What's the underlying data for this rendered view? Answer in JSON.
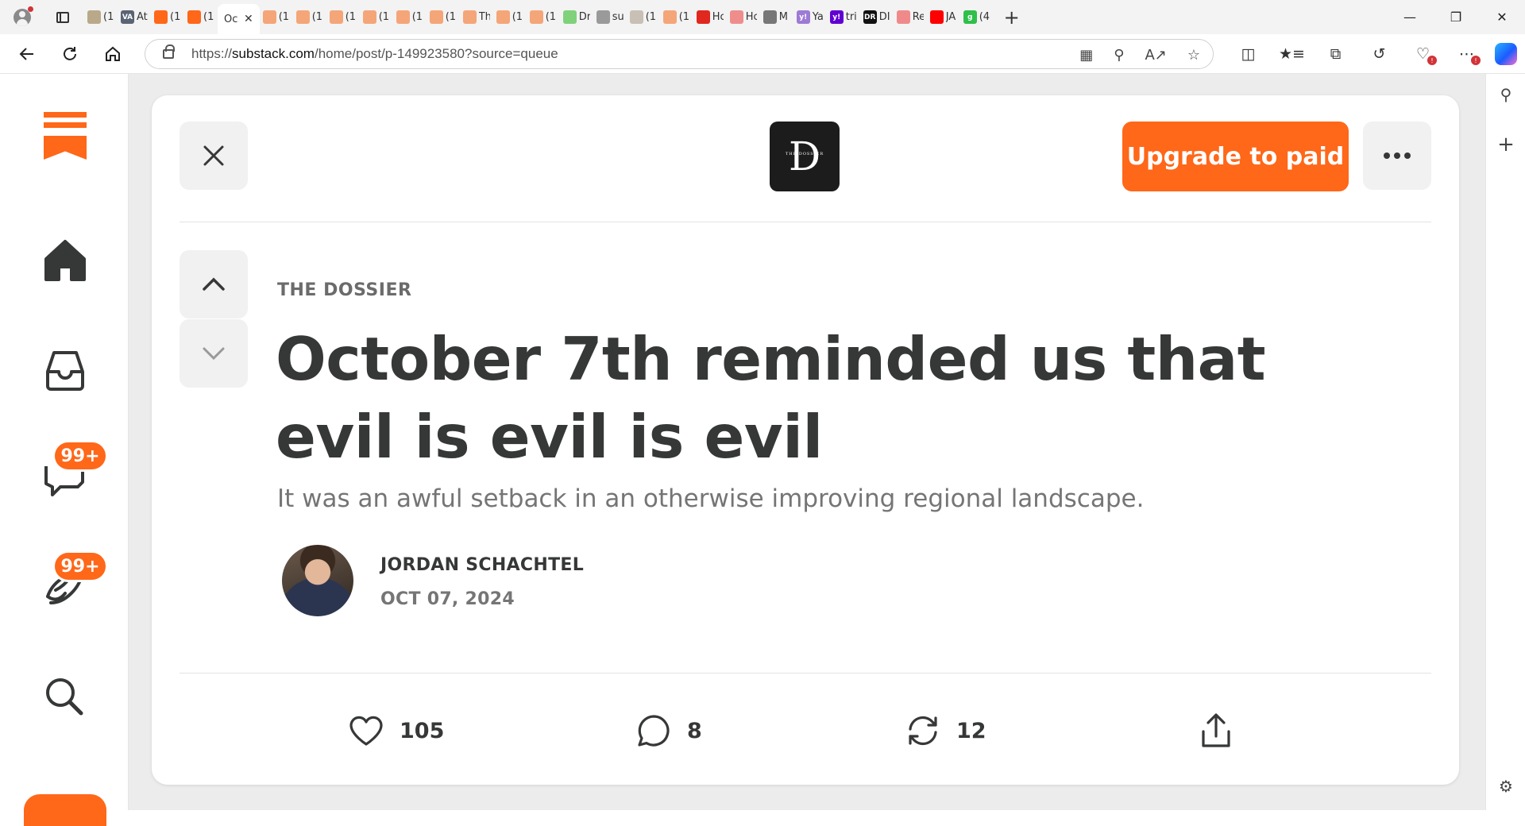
{
  "browser": {
    "active_tab_title": "Oc",
    "tabs": [
      {
        "title": "(1(",
        "icon": "image-thumb-icon",
        "color": "#b9a98a"
      },
      {
        "title": "At",
        "icon": "va-icon",
        "color": "#5a6473",
        "glyph": "VA"
      },
      {
        "title": "(1(",
        "icon": "substack-icon",
        "color": "#ff6719"
      },
      {
        "title": "(1(",
        "icon": "substack-icon",
        "color": "#ff6719"
      },
      {
        "title": "(1(",
        "icon": "substack-icon",
        "color": "#f4a679"
      },
      {
        "title": "(1(",
        "icon": "substack-icon",
        "color": "#f4a679"
      },
      {
        "title": "(1(",
        "icon": "substack-icon",
        "color": "#f4a679"
      },
      {
        "title": "(1(",
        "icon": "substack-icon",
        "color": "#f4a679"
      },
      {
        "title": "(1(",
        "icon": "substack-icon",
        "color": "#f4a679"
      },
      {
        "title": "(1(",
        "icon": "substack-icon",
        "color": "#f4a679"
      },
      {
        "title": "Th",
        "icon": "substack-icon",
        "color": "#f4a679"
      },
      {
        "title": "(1(",
        "icon": "substack-icon",
        "color": "#f4a679"
      },
      {
        "title": "(1(",
        "icon": "substack-icon",
        "color": "#f4a679"
      },
      {
        "title": "Dr",
        "icon": "play-icon",
        "color": "#7fd27a"
      },
      {
        "title": "su",
        "icon": "doc-search-icon",
        "color": "#9a9a9a"
      },
      {
        "title": "(1(",
        "icon": "image-thumb-icon",
        "color": "#c8c0b5"
      },
      {
        "title": "(1(",
        "icon": "substack-icon",
        "color": "#f4a679"
      },
      {
        "title": "Hc",
        "icon": "podcast-icon",
        "color": "#e0281e"
      },
      {
        "title": "Hc",
        "icon": "podcast-icon",
        "color": "#ef8d8d"
      },
      {
        "title": "M",
        "icon": "search-icon",
        "color": "#777777"
      },
      {
        "title": "Ya",
        "icon": "yahoo-icon",
        "color": "#9d7ad6",
        "glyph": "y!"
      },
      {
        "title": "tri",
        "icon": "yahoo-icon",
        "color": "#6001d2",
        "glyph": "y!"
      },
      {
        "title": "DI",
        "icon": "dr-icon",
        "color": "#111111",
        "glyph": "DR"
      },
      {
        "title": "Re",
        "icon": "youtube-icon",
        "color": "#f08a8a"
      },
      {
        "title": "JA",
        "icon": "youtube-icon",
        "color": "#ff0000"
      },
      {
        "title": "(4",
        "icon": "g-icon",
        "color": "#2fbf4a",
        "glyph": "g"
      }
    ],
    "url_prefix": "https://",
    "url_host": "substack.com",
    "url_path": "/home/post/p-149923580?source=queue"
  },
  "substack": {
    "brand_color": "#ff6719",
    "nav_badges": {
      "chat": "99+",
      "activity": "99+"
    },
    "publication_logo_letter": "D",
    "publication_logo_caption": "THE DOSSIER",
    "upgrade_label": "Upgrade to paid",
    "publication_name": "THE DOSSIER",
    "title": "October 7th reminded us that evil is evil is evil",
    "subtitle": "It was an awful setback in an otherwise improving regional landscape.",
    "author": "JORDAN SCHACHTEL",
    "date": "OCT 07, 2024",
    "actions": {
      "likes": "105",
      "comments": "8",
      "restacks": "12"
    }
  }
}
